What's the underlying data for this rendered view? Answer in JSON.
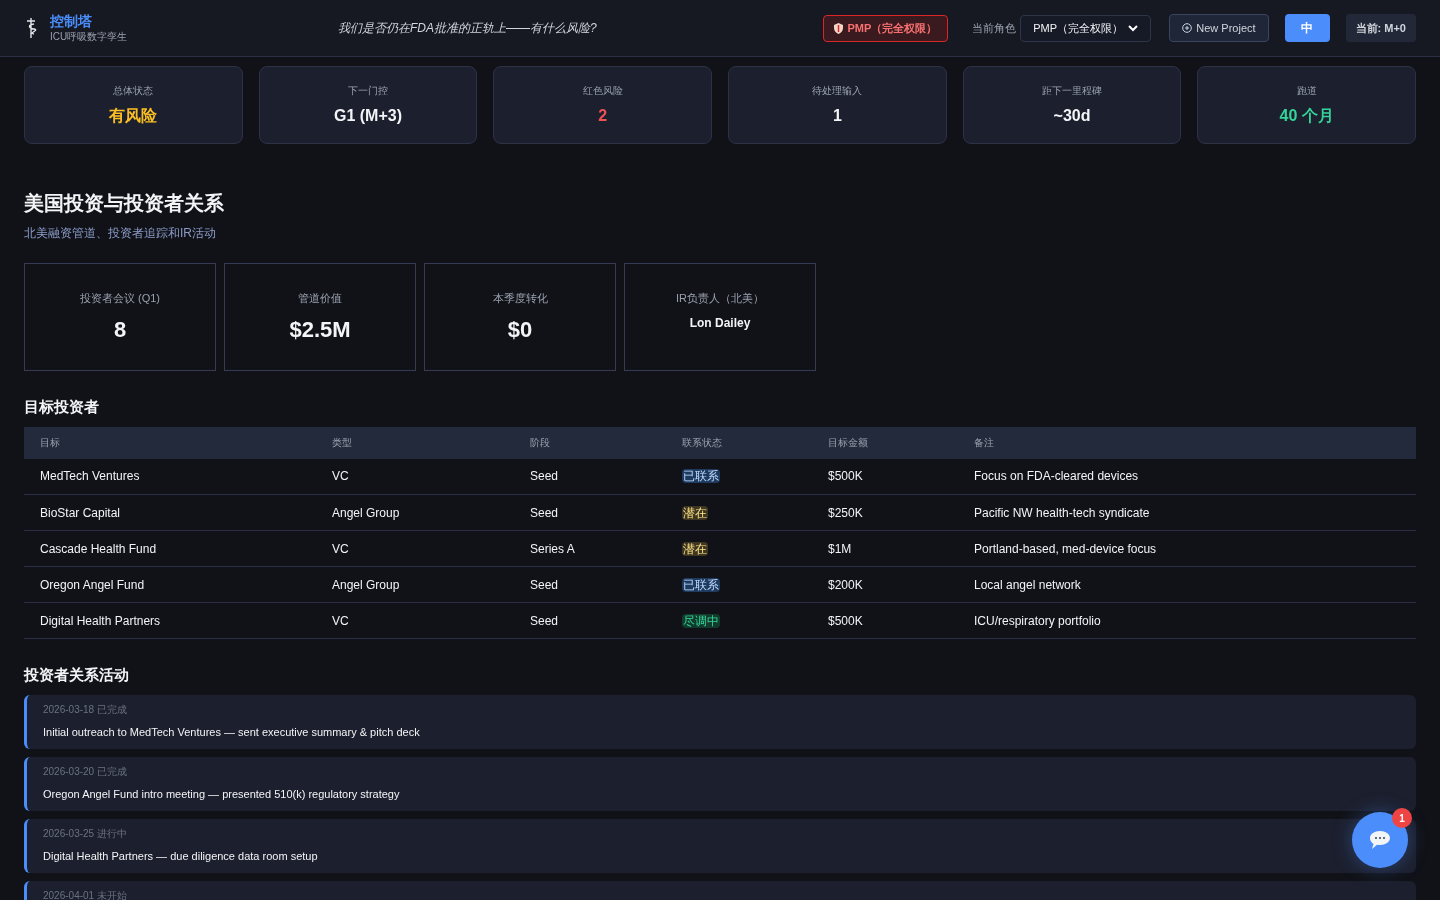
{
  "header": {
    "title": "控制塔",
    "subtitle": "ICU呼吸数字孪生",
    "question": "我们是否仍在FDA批准的正轨上——有什么风险?",
    "role_badge": "PMP（完全权限）",
    "role_label": "当前角色",
    "role_select": "PMP（完全权限）",
    "new_project": "New Project",
    "lang_button": "中",
    "current": "当前: M+0"
  },
  "kpis": [
    {
      "label": "总体状态",
      "value": "有风险",
      "color": "#fbbf24"
    },
    {
      "label": "下一门控",
      "value": "G1 (M+3)",
      "color": "#f3f4f6"
    },
    {
      "label": "红色风险",
      "value": "2",
      "color": "#f05252"
    },
    {
      "label": "待处理输入",
      "value": "1",
      "color": "#f3f4f6"
    },
    {
      "label": "距下一里程碑",
      "value": "~30d",
      "color": "#f3f4f6"
    },
    {
      "label": "跑道",
      "value": "40 个月",
      "color": "#34d399"
    }
  ],
  "section": {
    "title": "美国投资与投资者关系",
    "subtitle": "北美融资管道、投资者追踪和IR活动"
  },
  "stats": [
    {
      "label": "投资者会议 (Q1)",
      "value": "8",
      "kind": "big"
    },
    {
      "label": "管道价值",
      "value": "$2.5M",
      "kind": "big"
    },
    {
      "label": "本季度转化",
      "value": "$0",
      "kind": "big"
    },
    {
      "label": "IR负责人（北美）",
      "value": "Lon Dailey",
      "kind": "small"
    }
  ],
  "investors": {
    "title": "目标投资者",
    "columns": [
      "目标",
      "类型",
      "阶段",
      "联系状态",
      "目标金额",
      "备注"
    ],
    "rows": [
      {
        "name": "MedTech Ventures",
        "type": "VC",
        "stage": "Seed",
        "status": "已联系",
        "color": "#1e3a5f",
        "amount": "$500K",
        "note": "Focus on FDA-cleared devices"
      },
      {
        "name": "BioStar Capital",
        "type": "Angel Group",
        "stage": "Seed",
        "status": "潜在",
        "color": "#3f3621",
        "amount": "$250K",
        "note": "Pacific NW health-tech syndicate"
      },
      {
        "name": "Cascade Health Fund",
        "type": "VC",
        "stage": "Series A",
        "status": "潜在",
        "color": "#3f3621",
        "amount": "$1M",
        "note": "Portland-based, med-device focus"
      },
      {
        "name": "Oregon Angel Fund",
        "type": "Angel Group",
        "stage": "Seed",
        "status": "已联系",
        "color": "#1e3a5f",
        "amount": "$200K",
        "note": "Local angel network"
      },
      {
        "name": "Digital Health Partners",
        "type": "VC",
        "stage": "Seed",
        "status": "尽调中",
        "color": "#133b2c",
        "amount": "$500K",
        "note": "ICU/respiratory portfolio"
      }
    ]
  },
  "activities": {
    "title": "投资者关系活动",
    "items": [
      {
        "meta": "2026-03-18 已完成",
        "text": "Initial outreach to MedTech Ventures — sent executive summary & pitch deck"
      },
      {
        "meta": "2026-03-20 已完成",
        "text": "Oregon Angel Fund intro meeting — presented 510(k) regulatory strategy"
      },
      {
        "meta": "2026-03-25 进行中",
        "text": "Digital Health Partners — due diligence data room setup"
      },
      {
        "meta": "2026-04-01 未开始"
      }
    ]
  },
  "chat": {
    "badge": "1"
  }
}
